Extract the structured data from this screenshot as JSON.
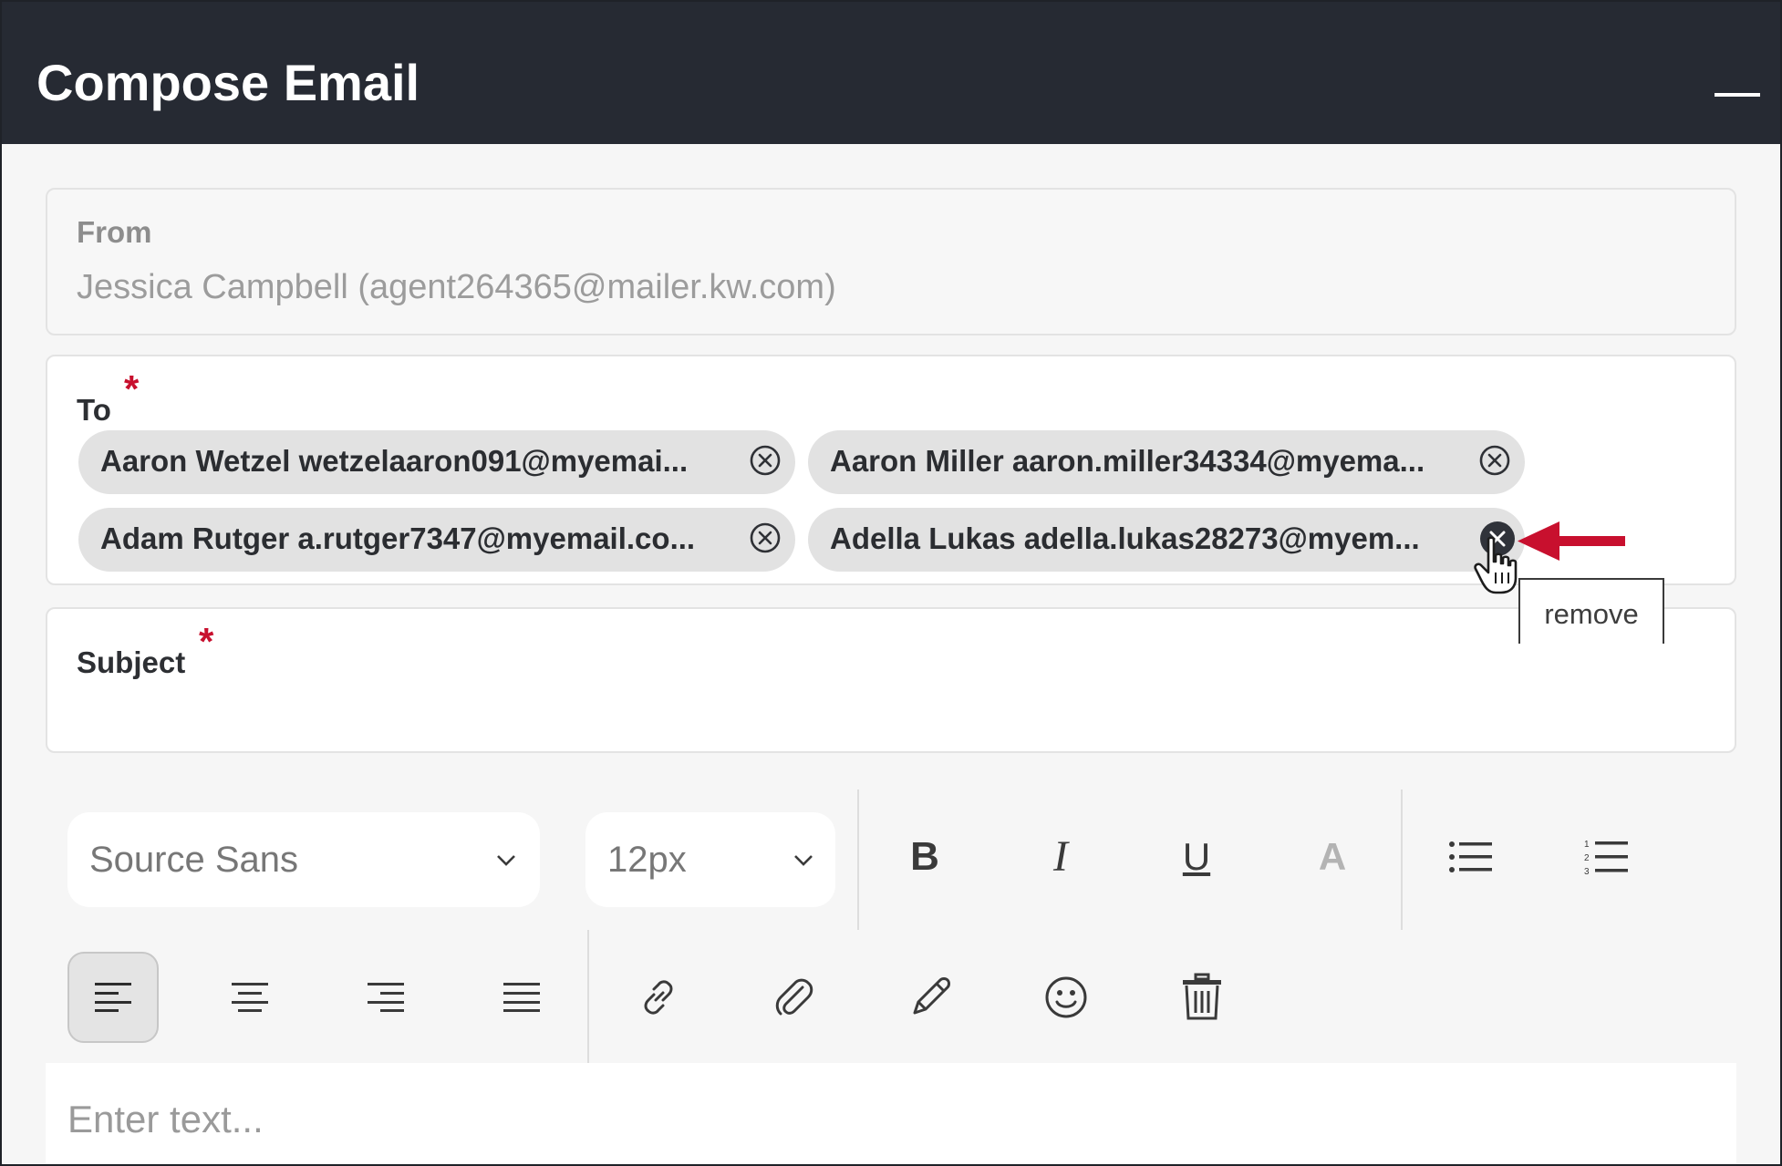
{
  "window": {
    "title": "Compose Email"
  },
  "from": {
    "label": "From",
    "value": "Jessica Campbell (agent264365@mailer.kw.com)"
  },
  "to": {
    "label": "To",
    "required_mark": "*",
    "recipients": [
      {
        "text": "Aaron Wetzel wetzelaaron091@myemai..."
      },
      {
        "text": "Aaron Miller aaron.miller34334@myema..."
      },
      {
        "text": "Adam Rutger a.rutger7347@myemail.co..."
      },
      {
        "text": "Adella Lukas adella.lukas28273@myem..."
      }
    ]
  },
  "tooltip": {
    "text": "remove"
  },
  "subject": {
    "label": "Subject",
    "required_mark": "*",
    "value": ""
  },
  "toolbar": {
    "font_family": "Source Sans",
    "font_size": "12px",
    "bold": "B",
    "italic": "I",
    "underline": "U",
    "text_color": "A"
  },
  "editor": {
    "placeholder": "Enter text..."
  },
  "colors": {
    "accent_red": "#c8102e",
    "titlebar": "#262a33"
  }
}
